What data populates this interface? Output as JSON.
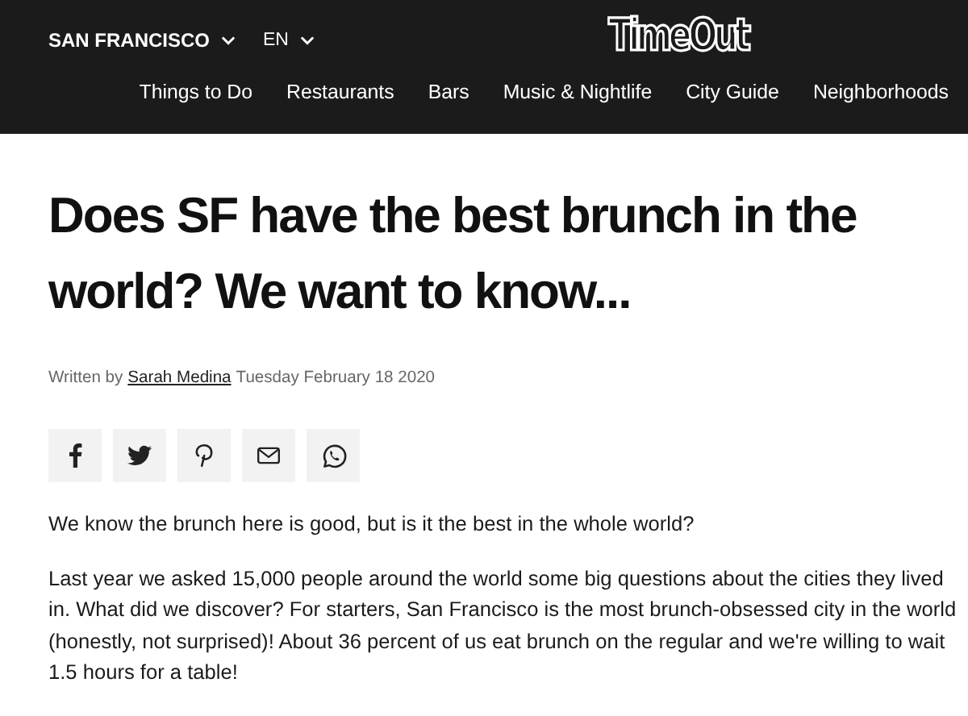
{
  "header": {
    "city": "SAN FRANCISCO",
    "language": "EN",
    "logo": "TimeOut",
    "nav": [
      "Things to Do",
      "Restaurants",
      "Bars",
      "Music & Nightlife",
      "City Guide",
      "Neighborhoods"
    ]
  },
  "article": {
    "title": "Does SF have the best brunch in the world? We want to know...",
    "byline": {
      "prefix": "Written by",
      "author": "Sarah Medina",
      "date": "Tuesday February 18 2020"
    },
    "share": [
      {
        "kind": "facebook"
      },
      {
        "kind": "twitter"
      },
      {
        "kind": "pinterest"
      },
      {
        "kind": "email"
      },
      {
        "kind": "whatsapp"
      }
    ],
    "paragraphs": [
      "We know the brunch here is good, but is it the best in the whole world?",
      "Last year we asked 15,000 people around the world some big questions about the cities they lived in. What did we discover? For starters, San Francisco is the most brunch-obsessed city in the world (honestly, not surprised)! About 36 percent of us eat brunch on the regular and we're willing to wait 1.5 hours for a table!"
    ]
  }
}
